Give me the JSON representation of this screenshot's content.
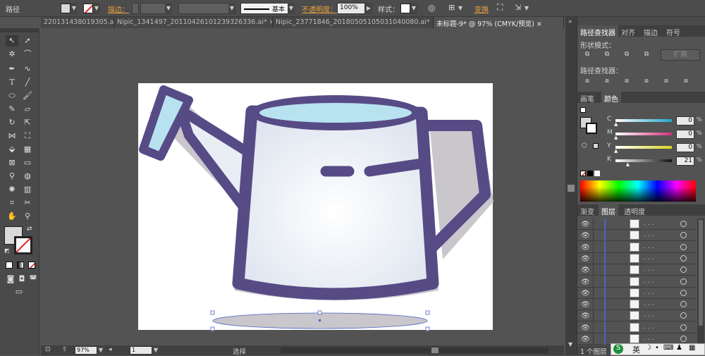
{
  "control_bar": {
    "object_type": "路径",
    "stroke_label": "描边：",
    "stroke_style": "基本",
    "opacity_label": "不透明度：",
    "opacity_value": "100%",
    "style_label": "样式：",
    "transform_label": "变换"
  },
  "tabs": [
    {
      "label": "220131438019305.ai",
      "active": false
    },
    {
      "label": "Nipic_1341497_20110426101239326336.ai*",
      "active": false
    },
    {
      "label": "Nipic_23771846_20180505105031040080.ai*",
      "active": false
    },
    {
      "label": "未标题-9* @ 97% (CMYK/预览)",
      "active": true
    }
  ],
  "close_glyph": "×",
  "panels": {
    "pathfinder": {
      "tabs": [
        "路径查找器",
        "对齐",
        "描边",
        "符号"
      ],
      "shape_modes_label": "形状模式：",
      "expand_label": "扩展",
      "pathfinders_label": "路径查找器："
    },
    "color": {
      "tabs": [
        "画笔",
        "颜色"
      ],
      "channels": [
        {
          "name": "C",
          "value": "0",
          "color": "#22a6c9"
        },
        {
          "name": "M",
          "value": "0",
          "color": "#d0317f"
        },
        {
          "name": "Y",
          "value": "0",
          "color": "#d9d61f"
        },
        {
          "name": "K",
          "value": "21",
          "color": "#111111"
        }
      ],
      "percent": "%"
    },
    "layers": {
      "tabs": [
        "渐变",
        "图层",
        "透明度"
      ],
      "row_count": 11,
      "footer": "1 个图层"
    }
  },
  "status_bar": {
    "zoom": "97%",
    "page": "1",
    "tool": "选择"
  },
  "tray": {
    "ime": "英"
  },
  "colors": {
    "watering_can_outline": "#574b86",
    "watering_can_fill": "#e9eef5",
    "water_top": "#b8e2ef",
    "shadow": "#c9c6cc"
  }
}
